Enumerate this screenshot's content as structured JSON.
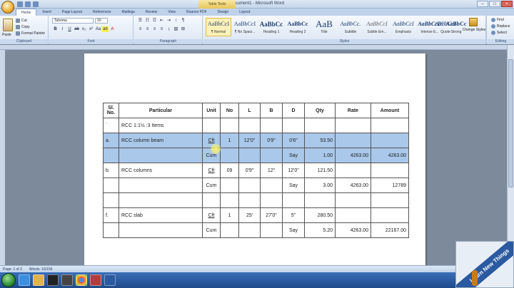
{
  "window": {
    "title": "Document1 - Microsoft Word",
    "context_tab": "Table Tools"
  },
  "tabs": [
    "Home",
    "Insert",
    "Page Layout",
    "References",
    "Mailings",
    "Review",
    "View",
    "Nuance PDF",
    "Design",
    "Layout"
  ],
  "ribbon": {
    "clipboard": {
      "paste": "Paste",
      "cut": "Cut",
      "copy": "Copy",
      "painter": "Format Painter",
      "label": "Clipboard"
    },
    "font": {
      "name": "Tahoma",
      "size": "10",
      "label": "Font"
    },
    "paragraph": {
      "label": "Paragraph"
    },
    "styles": {
      "label": "Styles",
      "items": [
        {
          "sample": "AaBbCcI",
          "name": "¶ Normal"
        },
        {
          "sample": "AaBbCcI",
          "name": "¶ No Spaci..."
        },
        {
          "sample": "AaBbCc",
          "name": "Heading 1"
        },
        {
          "sample": "AaBbCc",
          "name": "Heading 2"
        },
        {
          "sample": "AaB",
          "name": "Title"
        },
        {
          "sample": "AaBbCc.",
          "name": "Subtitle"
        },
        {
          "sample": "AaBbCcI",
          "name": "Subtle Em..."
        },
        {
          "sample": "AaBbCcI",
          "name": "Emphasis"
        },
        {
          "sample": "AaBbCcD",
          "name": "Intense E..."
        },
        {
          "sample": "AaBbCc",
          "name": "Strong"
        },
        {
          "sample": "AaBbCcI",
          "name": "Quote"
        }
      ],
      "change": "Change Styles"
    },
    "editing": {
      "find": "Find",
      "replace": "Replace",
      "select": "Select",
      "label": "Editing"
    }
  },
  "table": {
    "headers": [
      "Sl. No.",
      "Particular",
      "Unit",
      "No",
      "L",
      "B",
      "D",
      "Qty",
      "Rate",
      "Amount"
    ],
    "rows": [
      [
        "`",
        "RCC 1:1½ :3 Items",
        "",
        "",
        "",
        "",
        "",
        "",
        "",
        ""
      ],
      [
        "a.",
        "RCC column beam",
        "Cft",
        "1",
        "12'0\"",
        "0'9\"",
        "0'6\"",
        "53.50",
        "",
        ""
      ],
      [
        "",
        "",
        "Cum",
        "",
        "",
        "",
        "Say",
        "1.00",
        "4263.00",
        "4263.00"
      ],
      [
        "b.",
        "RCC columns",
        "Cft",
        "09",
        "0'9\"",
        "12\"",
        "12'0\"",
        "121.50",
        "",
        ""
      ],
      [
        "",
        "",
        "Cum",
        "",
        "",
        "",
        "Say",
        "3.00",
        "4263.00",
        "12789"
      ],
      [
        "",
        "",
        "",
        "",
        "",
        "",
        "",
        "",
        "",
        ""
      ],
      [
        "f.",
        "RCC slab",
        "Cft",
        "1",
        "25'",
        "27'0\"",
        "5\"",
        "280.50",
        "",
        ""
      ],
      [
        "",
        "",
        "Cum",
        "",
        "",
        "",
        "Say",
        "5.20",
        "4263.00",
        "22167.00"
      ]
    ]
  },
  "status": {
    "page": "Page: 1 of 2",
    "words": "Words: 15/156"
  },
  "logo": {
    "text": "Learn New Things"
  }
}
